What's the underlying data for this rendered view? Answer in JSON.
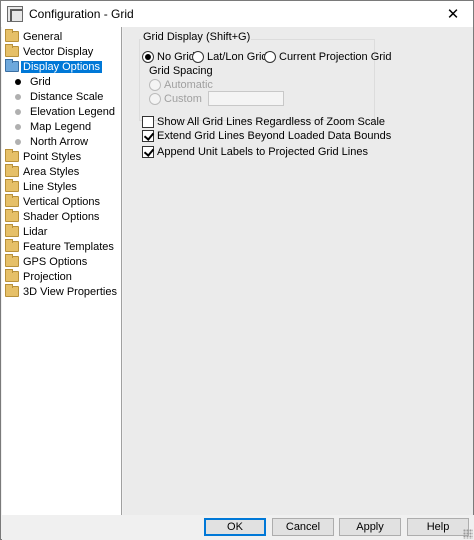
{
  "window": {
    "title": "Configuration - Grid",
    "close_glyph": "✕"
  },
  "tree": {
    "items": [
      {
        "label": "General",
        "icon": "folder-icon"
      },
      {
        "label": "Vector Display",
        "icon": "folder-icon"
      },
      {
        "label": "Display Options",
        "icon": "folder-open-icon",
        "selected": true
      },
      {
        "label": "Grid",
        "icon": "bullet-icon",
        "child": true,
        "active": true
      },
      {
        "label": "Distance Scale",
        "icon": "bullet-icon",
        "child": true
      },
      {
        "label": "Elevation Legend",
        "icon": "bullet-icon",
        "child": true
      },
      {
        "label": "Map Legend",
        "icon": "bullet-icon",
        "child": true
      },
      {
        "label": "North Arrow",
        "icon": "bullet-icon",
        "child": true
      },
      {
        "label": "Point Styles",
        "icon": "folder-icon"
      },
      {
        "label": "Area Styles",
        "icon": "folder-icon"
      },
      {
        "label": "Line Styles",
        "icon": "folder-icon"
      },
      {
        "label": "Vertical Options",
        "icon": "folder-icon"
      },
      {
        "label": "Shader Options",
        "icon": "folder-icon"
      },
      {
        "label": "Lidar",
        "icon": "folder-icon"
      },
      {
        "label": "Feature Templates",
        "icon": "folder-icon"
      },
      {
        "label": "GPS Options",
        "icon": "folder-icon"
      },
      {
        "label": "Projection",
        "icon": "folder-icon"
      },
      {
        "label": "3D View Properties",
        "icon": "folder-icon"
      }
    ]
  },
  "grid_display": {
    "legend": "Grid Display (Shift+G)",
    "options": [
      {
        "label": "No Grid",
        "checked": true
      },
      {
        "label": "Lat/Lon Grid",
        "checked": false
      },
      {
        "label": "Current Projection Grid",
        "checked": false
      }
    ],
    "spacing_label": "Grid Spacing",
    "spacing_options": [
      {
        "label": "Automatic",
        "disabled": true
      },
      {
        "label": "Custom",
        "disabled": true
      }
    ],
    "custom_value": ""
  },
  "checkboxes": [
    {
      "label": "Show All Grid Lines Regardless of Zoom Scale",
      "checked": false
    },
    {
      "label": "Extend Grid Lines Beyond Loaded Data Bounds",
      "checked": true
    },
    {
      "label": "Append Unit Labels to Projected Grid Lines",
      "checked": true
    }
  ],
  "buttons": {
    "ok": "OK",
    "cancel": "Cancel",
    "apply": "Apply",
    "help": "Help"
  }
}
